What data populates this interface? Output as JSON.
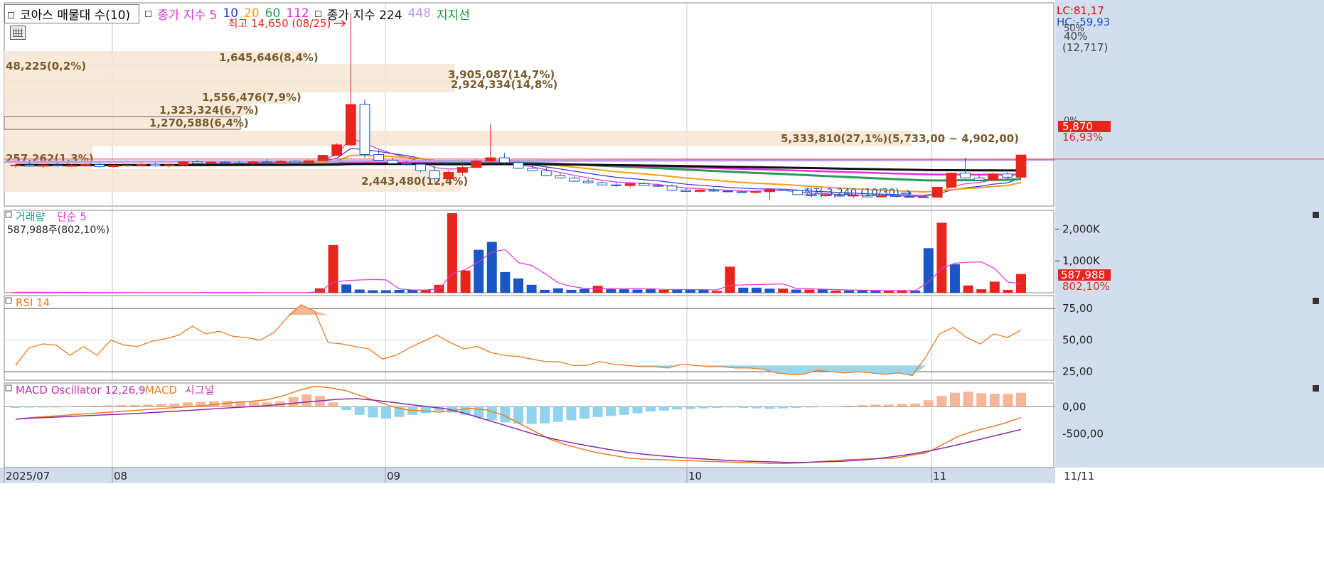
{
  "colors": {
    "up": "#e8251c",
    "down": "#1a56c4",
    "ma5": "#e034d4",
    "ma10": "#2a38c8",
    "ma20": "#f0a018",
    "ma60": "#2a9a5a",
    "ma112": "#e82ce0",
    "ma224": "#111111",
    "ma448": "#c29ae8",
    "support": "#1a9a3a",
    "rsi": "#f07a20",
    "macd": "#f07a20",
    "signal": "#8a2aa8",
    "osc_pos": "#f5b69a",
    "osc_neg": "#8fd4ee",
    "band": "#f6e6d4",
    "axisbg": "#d2deee"
  },
  "header": {
    "series_box": "코아스 매물대 수(10)",
    "ma_label": "종가 지수 5",
    "ma10": "10",
    "ma20": "20",
    "ma60": "60",
    "ma112": "112",
    "ma224_label": "종가 지수 224",
    "ma448": "448",
    "support_label": "지지선"
  },
  "price_panel": {
    "lc": "LC:81,17",
    "hc": "HC:-59,93",
    "axis_top": "50%",
    "axis_40": "40%",
    "axis_count": "(12,717)",
    "axis_zero": "0%",
    "current_price": "5,870",
    "current_change": "16,93%",
    "high_label": "최고 14,650 (08/25)",
    "low_label": "최저 3,240 (10/30)",
    "range_label": "5,333,810(27,1%)(5,733,00 ~ 4,902,00)"
  },
  "volume_band_labels": [
    "1,645,646(8,4%)",
    "48,225(0,2%)",
    "3,905,087(14,7%)",
    "2,924,334(14,8%)",
    "1,556,476(7,9%)",
    "1,323,324(6,7%)",
    "1,270,588(6,4%)",
    "257,262(1,3%)",
    "2,443,480(12,4%)"
  ],
  "volume_panel": {
    "title": "거래량",
    "ma_title": "단순 5",
    "subtitle": "587,988주(802,10%)",
    "tick_2000": "2,000K",
    "tick_1000": "1,000K",
    "current_value": "587,988",
    "current_pct": "802,10%"
  },
  "rsi_panel": {
    "title": "RSI 14",
    "tick_75": "75,00",
    "tick_50": "50,00",
    "tick_25": "25,00"
  },
  "macd_panel": {
    "title": "MACD Oscillator 12,26,9",
    "macd_title": "MACD",
    "signal_title": "시그널",
    "tick_0": "0,00",
    "tick_m500": "-500,00"
  },
  "x_axis": {
    "labels": [
      "2025/07",
      "08",
      "09",
      "10",
      "11"
    ],
    "end_label": "11/11"
  },
  "chart_data": [
    {
      "type": "candlestick",
      "title": "코아스 매물대 수(10)",
      "candles": [
        [
          5200,
          5300,
          5100,
          5250
        ],
        [
          5250,
          5400,
          5150,
          5180
        ],
        [
          5180,
          5300,
          5100,
          5250
        ],
        [
          5250,
          5350,
          5150,
          5200
        ],
        [
          5200,
          5300,
          5150,
          5220
        ],
        [
          5220,
          5350,
          5150,
          5280
        ],
        [
          5280,
          5400,
          5100,
          5150
        ],
        [
          5150,
          5300,
          5100,
          5230
        ],
        [
          5230,
          5350,
          5150,
          5240
        ],
        [
          5240,
          5400,
          5200,
          5300
        ],
        [
          5300,
          5400,
          5150,
          5200
        ],
        [
          5200,
          5350,
          5100,
          5260
        ],
        [
          5260,
          5500,
          5200,
          5450
        ],
        [
          5450,
          5550,
          5300,
          5350
        ],
        [
          5350,
          5500,
          5300,
          5430
        ],
        [
          5430,
          5500,
          5350,
          5380
        ],
        [
          5380,
          5500,
          5300,
          5350
        ],
        [
          5350,
          5500,
          5250,
          5450
        ],
        [
          5450,
          5600,
          5300,
          5400
        ],
        [
          5400,
          5550,
          5300,
          5480
        ],
        [
          5480,
          5550,
          5350,
          5400
        ],
        [
          5400,
          5600,
          5300,
          5520
        ],
        [
          5520,
          5900,
          5500,
          5850
        ],
        [
          5850,
          6600,
          5800,
          6500
        ],
        [
          6500,
          14650,
          6400,
          9000
        ],
        [
          9000,
          9300,
          5700,
          5900
        ],
        [
          5900,
          6200,
          5500,
          5550
        ],
        [
          5550,
          5700,
          5300,
          5350
        ],
        [
          5350,
          5500,
          5200,
          5300
        ],
        [
          5300,
          5400,
          4800,
          4900
        ],
        [
          4900,
          5200,
          4200,
          4400
        ],
        [
          4400,
          4900,
          4400,
          4800
        ],
        [
          4800,
          5300,
          4600,
          5100
        ],
        [
          5100,
          5600,
          5100,
          5500
        ],
        [
          5500,
          7800,
          5300,
          5700
        ],
        [
          5700,
          6000,
          5300,
          5400
        ],
        [
          5400,
          5500,
          5000,
          5050
        ],
        [
          5050,
          5250,
          4850,
          4900
        ],
        [
          4900,
          5100,
          4550,
          4600
        ],
        [
          4600,
          4800,
          4400,
          4450
        ],
        [
          4450,
          4550,
          4200,
          4250
        ],
        [
          4250,
          4400,
          4100,
          4150
        ],
        [
          4150,
          4250,
          4000,
          4020
        ],
        [
          4020,
          4200,
          3900,
          3980
        ],
        [
          3980,
          4150,
          3850,
          4100
        ],
        [
          4100,
          4200,
          3950,
          3980
        ],
        [
          3980,
          4100,
          3880,
          3950
        ],
        [
          3950,
          4050,
          3650,
          3700
        ],
        [
          3700,
          3800,
          3580,
          3620
        ],
        [
          3620,
          3750,
          3550,
          3700
        ],
        [
          3700,
          3850,
          3600,
          3640
        ],
        [
          3640,
          3700,
          3560,
          3600
        ],
        [
          3600,
          3650,
          3550,
          3580
        ],
        [
          3580,
          3650,
          3500,
          3600
        ],
        [
          3600,
          3650,
          3100,
          3750
        ],
        [
          3750,
          3780,
          3650,
          3680
        ],
        [
          3680,
          3700,
          3400,
          3420
        ],
        [
          3420,
          3500,
          3300,
          3350
        ],
        [
          3350,
          3450,
          3280,
          3420
        ],
        [
          3420,
          3500,
          3300,
          3330
        ],
        [
          3330,
          3400,
          3200,
          3380
        ],
        [
          3380,
          3450,
          3250,
          3280
        ],
        [
          3280,
          3400,
          3250,
          3360
        ],
        [
          3360,
          3450,
          3300,
          3300
        ],
        [
          3300,
          3350,
          3240,
          3280
        ],
        [
          3280,
          3300,
          3240,
          3260
        ],
        [
          3260,
          3900,
          3240,
          3880
        ],
        [
          3880,
          4800,
          3800,
          4750
        ],
        [
          4750,
          5700,
          4400,
          4450
        ],
        [
          4450,
          4600,
          4300,
          4320
        ],
        [
          4320,
          4800,
          4250,
          4700
        ],
        [
          4700,
          4800,
          4450,
          4500
        ],
        [
          4500,
          5870,
          4450,
          5870
        ]
      ],
      "high": {
        "value": 14650,
        "date": "08/25"
      },
      "low": {
        "value": 3240,
        "date": "10/30"
      },
      "current": 5870
    },
    {
      "type": "bar",
      "title": "거래량",
      "values": [
        15,
        12,
        10,
        9,
        8,
        6,
        5,
        5,
        4,
        4,
        4,
        4,
        4,
        4,
        14,
        4,
        4,
        4,
        4,
        5,
        5,
        8,
        12,
        140,
        1500,
        260,
        100,
        80,
        80,
        90,
        90,
        90,
        250,
        2500,
        700,
        1350,
        1600,
        650,
        450,
        250,
        90,
        140,
        90,
        120,
        220,
        110,
        110,
        100,
        110,
        90,
        100,
        100,
        90,
        60,
        820,
        160,
        160,
        130,
        130,
        100,
        100,
        100,
        70,
        70,
        75,
        60,
        60,
        80,
        70,
        1400,
        2200,
        900,
        230,
        110,
        350,
        90,
        590
      ],
      "ma5_ylim": [
        0,
        2500
      ]
    },
    {
      "type": "line",
      "title": "RSI 14",
      "values": [
        30,
        44,
        47,
        46,
        38,
        45,
        38,
        50,
        46,
        45,
        49,
        51,
        54,
        61,
        55,
        57,
        53,
        52,
        50,
        56,
        68,
        78,
        73,
        48,
        47,
        45,
        43,
        35,
        38,
        44,
        49,
        54,
        48,
        43,
        45,
        40,
        38,
        37,
        35,
        33,
        33,
        30,
        30,
        33,
        31,
        30,
        29,
        29,
        28,
        31,
        30,
        29,
        29,
        28,
        28,
        27,
        24,
        23,
        23,
        26,
        25,
        24,
        25,
        24,
        23,
        24,
        22,
        37,
        55,
        60,
        52,
        47,
        55,
        52,
        58
      ],
      "ylim": [
        20,
        83
      ]
    },
    {
      "type": "bar",
      "title": "MACD Oscillator 12,26,9",
      "osc": [
        -20,
        -15,
        -10,
        0,
        10,
        15,
        20,
        25,
        30,
        30,
        40,
        50,
        60,
        80,
        90,
        100,
        110,
        100,
        90,
        80,
        100,
        180,
        230,
        200,
        80,
        -60,
        -150,
        -200,
        -220,
        -190,
        -150,
        -120,
        -80,
        -110,
        -150,
        -200,
        -250,
        -290,
        -310,
        -320,
        -310,
        -280,
        -250,
        -220,
        -190,
        -170,
        -150,
        -120,
        -90,
        -70,
        -50,
        -40,
        -30,
        -20,
        -10,
        -20,
        -30,
        -40,
        -30,
        -20,
        -10,
        5,
        10,
        20,
        30,
        40,
        40,
        50,
        60,
        120,
        200,
        260,
        280,
        250,
        240,
        240,
        260
      ],
      "macd": [
        -230,
        -200,
        -180,
        -160,
        -140,
        -120,
        -100,
        -80,
        -60,
        -40,
        -20,
        0,
        20,
        50,
        80,
        100,
        130,
        200,
        300,
        380,
        350,
        300,
        200,
        100,
        0,
        -60,
        -80,
        -100,
        -60,
        -30,
        -60,
        -150,
        -300,
        -450,
        -600,
        -700,
        -780,
        -850,
        -900,
        -950,
        -970,
        -980,
        -990,
        -1000,
        -1010,
        -1020,
        -1030,
        -1040,
        -1050,
        -1050,
        -1040,
        -1020,
        -1000,
        -980,
        -970,
        -960,
        -950,
        -900,
        -850,
        -700,
        -550,
        -450,
        -380,
        -300,
        -200
      ],
      "signal": [
        -230,
        -210,
        -195,
        -180,
        -165,
        -150,
        -135,
        -120,
        -100,
        -80,
        -60,
        -40,
        -20,
        0,
        20,
        50,
        80,
        110,
        140,
        150,
        120,
        80,
        40,
        0,
        -40,
        -120,
        -220,
        -320,
        -420,
        -520,
        -600,
        -670,
        -730,
        -790,
        -840,
        -880,
        -910,
        -940,
        -960,
        -980,
        -1000,
        -1010,
        -1020,
        -1030,
        -1030,
        -1020,
        -1010,
        -990,
        -960,
        -920,
        -870,
        -810,
        -740,
        -660,
        -580,
        -500,
        -420
      ],
      "ylim": [
        -1100,
        400
      ]
    }
  ]
}
